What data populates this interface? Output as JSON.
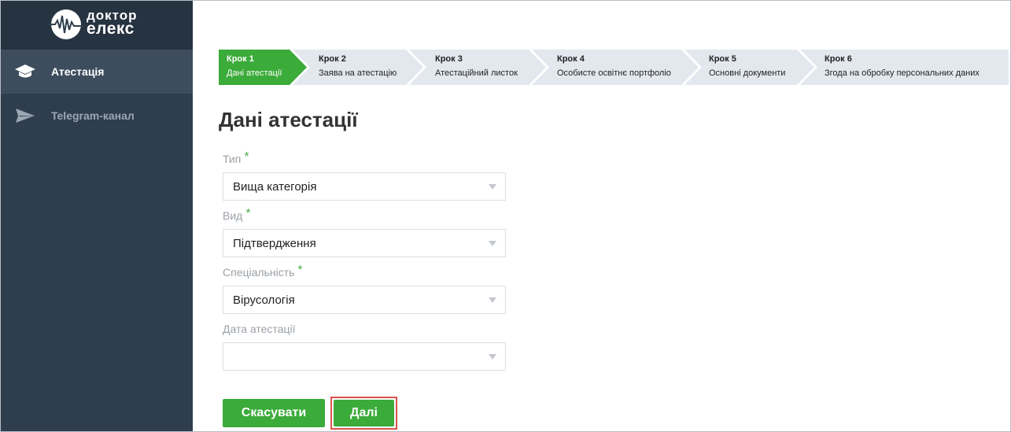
{
  "brand": {
    "line1": "доктор",
    "line2": "елекс"
  },
  "sidebar": {
    "items": [
      {
        "label": "Атестація",
        "icon": "graduation-cap-icon",
        "active": true
      },
      {
        "label": "Telegram-канал",
        "icon": "paper-plane-icon",
        "active": false
      }
    ]
  },
  "wizard": {
    "steps": [
      {
        "step": "Крок 1",
        "title": "Дані атестації",
        "active": true
      },
      {
        "step": "Крок 2",
        "title": "Заява на атестацію",
        "active": false
      },
      {
        "step": "Крок 3",
        "title": "Атестаційний листок",
        "active": false
      },
      {
        "step": "Крок 4",
        "title": "Особисте освітнє портфоліо",
        "active": false
      },
      {
        "step": "Крок 5",
        "title": "Основні документи",
        "active": false
      },
      {
        "step": "Крок 6",
        "title": "Згода на обробку персональних даних",
        "active": false
      }
    ]
  },
  "page": {
    "title": "Дані атестації"
  },
  "form": {
    "type": {
      "label": "Тип",
      "required": "*",
      "value": "Вища категорія"
    },
    "kind": {
      "label": "Вид",
      "required": "*",
      "value": "Підтвердження"
    },
    "specialty": {
      "label": "Спеціальність",
      "required": "*",
      "value": "Вірусологія"
    },
    "date": {
      "label": "Дата атестації",
      "value": ""
    }
  },
  "buttons": {
    "cancel": "Скасувати",
    "next": "Далі"
  },
  "colors": {
    "sidebar": "#2f3e4e",
    "sidebar_active": "#3d4d5e",
    "accent_green": "#3bab3a",
    "step_inactive": "#e3e8ef",
    "highlight_red": "#d9534f"
  }
}
